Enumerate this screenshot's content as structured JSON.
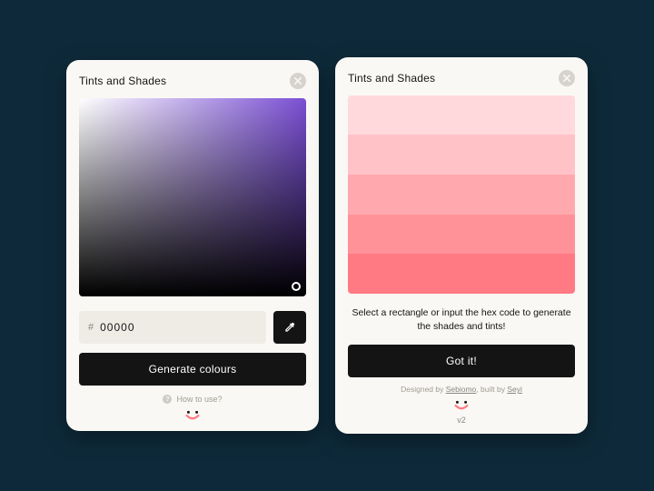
{
  "left": {
    "title": "Tints and Shades",
    "hex_prefix": "#",
    "hex_value": "00000",
    "generate_label": "Generate colours",
    "help_label": "How to use?"
  },
  "right": {
    "title": "Tints and Shades",
    "swatches": [
      "#ffd9dc",
      "#ffc2c7",
      "#ffa9ae",
      "#ff9298",
      "#ff7a82"
    ],
    "instruction": "Select a rectangle or input the hex code to generate the shades and tints!",
    "cta_label": "Got it!",
    "credits_designed": "Designed by ",
    "credits_designer": "Sebiomo",
    "credits_built": ", built by ",
    "credits_builder": "Seyi",
    "version": "v2"
  }
}
